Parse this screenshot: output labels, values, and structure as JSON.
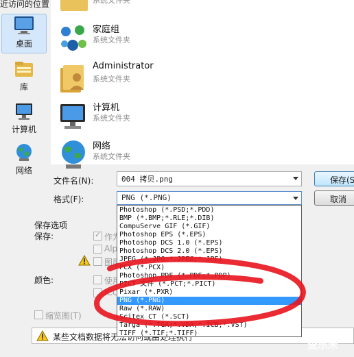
{
  "nav": {
    "partial_label": "近访问的位置",
    "items": [
      {
        "label": "桌面",
        "icon": "desktop-icon",
        "selected": true
      },
      {
        "label": "库",
        "icon": "library-icon",
        "selected": false
      },
      {
        "label": "计算机",
        "icon": "computer-icon",
        "selected": false
      },
      {
        "label": "网络",
        "icon": "network-icon",
        "selected": false
      }
    ]
  },
  "files": [
    {
      "name": "",
      "type": "系统文件夹",
      "icon": "folder-icon"
    },
    {
      "name": "家庭组",
      "type": "系统文件夹",
      "icon": "homegroup-icon"
    },
    {
      "name": "Administrator",
      "type": "系统文件夹",
      "icon": "user-folder-icon"
    },
    {
      "name": "计算机",
      "type": "系统文件夹",
      "icon": "computer-icon"
    },
    {
      "name": "网络",
      "type": "系统文件夹",
      "icon": "network-icon"
    }
  ],
  "form": {
    "filename_label": "文件名(N):",
    "filename_value": "004 拷贝.png",
    "format_label": "格式(F):",
    "format_value": "PNG (*.PNG)",
    "save_button": "保存(S",
    "cancel_button": "取消"
  },
  "options": {
    "title": "保存选项",
    "save_label": "保存:",
    "as_copy": "作为",
    "alpha": "Alph",
    "layers": "图层",
    "color_label": "颜色:",
    "use_proof": "使用",
    "icc": "ICC",
    "thumbnail": "缩览图(T)",
    "warning": "某些文档数据将无法访问或由处理执行"
  },
  "format_list": [
    "Photoshop (*.PSD;*.PDD)",
    "BMP (*.BMP;*.RLE;*.DIB)",
    "CompuServe GIF (*.GIF)",
    "Photoshop EPS (*.EPS)",
    "Photoshop DCS 1.0 (*.EPS)",
    "Photoshop DCS 2.0 (*.EPS)",
    "JPEG (*.JPG;*.JPEG;*.JPE)",
    "PCX (*.PCX)",
    "Photoshop PDF (*.PDF;*.PDP)",
    "PICT 文件 (*.PCT;*.PICT)",
    "Pixar (*.PXR)",
    "PNG (*.PNG)",
    "Raw (*.RAW)",
    "Scitex CT (*.SCT)",
    "Targa (*.TGA;*.VDA;*.ICB;*.VST)",
    "TIFF (*.TIF;*.TIFF)"
  ],
  "selected_format_index": 11,
  "watermark": "查乐米",
  "colors": {
    "accent": "#3399ff",
    "annotation": "#e8141e",
    "nav_selected": "#d5e7fa"
  }
}
